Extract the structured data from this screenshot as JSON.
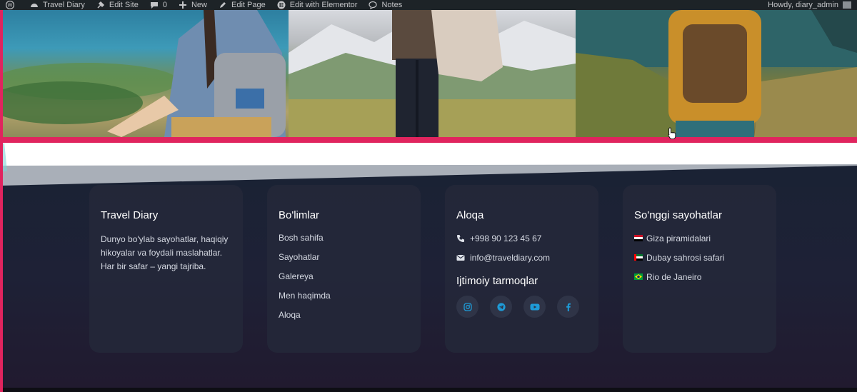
{
  "adminbar": {
    "site_name": "Travel Diary",
    "edit_site": "Edit Site",
    "comments_count": "0",
    "new_label": "New",
    "edit_page": "Edit Page",
    "elementor": "Edit with Elementor",
    "notes": "Notes",
    "howdy": "Howdy, diary_admin"
  },
  "footer": {
    "about": {
      "title": "Travel Diary",
      "text": "Dunyo bo'ylab sayohatlar, haqiqiy hikoyalar va foydali maslahatlar. Har bir safar – yangi tajriba."
    },
    "sections": {
      "title": "Bo'limlar",
      "items": [
        "Bosh sahifa",
        "Sayohatlar",
        "Galereya",
        "Men haqimda",
        "Aloqa"
      ]
    },
    "contact": {
      "title": "Aloqa",
      "phone": "+998 90 123 45 67",
      "email": "info@traveldiary.com",
      "social_title": "Ijtimoiy tarmoqlar",
      "socials": [
        "instagram-icon",
        "telegram-icon",
        "youtube-icon",
        "facebook-icon"
      ],
      "accent_color": "#1e9bd7"
    },
    "recent": {
      "title": "So'nggi sayohatlar",
      "items": [
        "Giza piramidalari",
        "Dubay sahrosi safari",
        "Rio de Janeiro"
      ]
    }
  },
  "colors": {
    "accent": "#e0245e",
    "footer_bg": "#1d2134",
    "card_bg": "#24283a"
  }
}
